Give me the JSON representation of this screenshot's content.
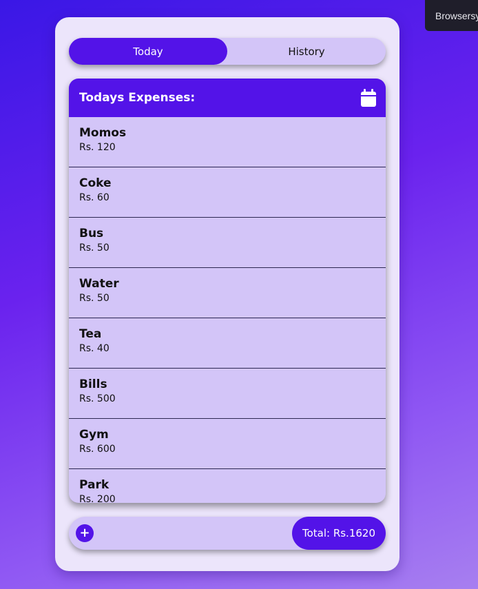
{
  "tabs": {
    "today": "Today",
    "history": "History",
    "active": "today"
  },
  "panel": {
    "title": "Todays Expenses:",
    "icon": "calendar-icon"
  },
  "expenses": [
    {
      "name": "Momos",
      "amount": "Rs. 120"
    },
    {
      "name": "Coke",
      "amount": "Rs. 60"
    },
    {
      "name": "Bus",
      "amount": "Rs. 50"
    },
    {
      "name": "Water",
      "amount": "Rs. 50"
    },
    {
      "name": "Tea",
      "amount": "Rs. 40"
    },
    {
      "name": "Bills",
      "amount": "Rs. 500"
    },
    {
      "name": "Gym",
      "amount": "Rs. 600"
    },
    {
      "name": "Park",
      "amount": "Rs. 200"
    }
  ],
  "footer": {
    "add_label": "+",
    "total": "Total: Rs.1620"
  },
  "overlay": {
    "badge_text": "Browsersync"
  },
  "colors": {
    "accent": "#5313e8",
    "panel": "#d3c5f8",
    "card": "#ece5fb"
  }
}
